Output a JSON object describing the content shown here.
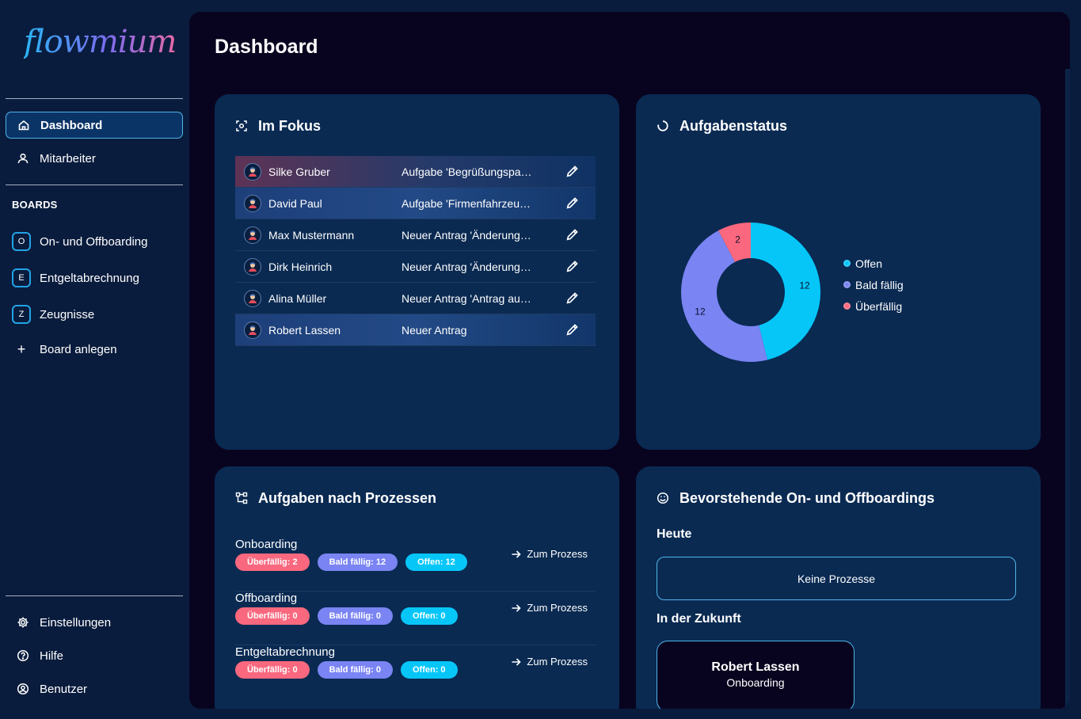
{
  "app": {
    "logo_text": "flowmium"
  },
  "sidebar": {
    "nav": [
      {
        "label": "Dashboard",
        "icon": "home-icon",
        "active": true
      },
      {
        "label": "Mitarbeiter",
        "icon": "user-icon",
        "active": false
      }
    ],
    "boards_heading": "BOARDS",
    "boards": [
      {
        "badge": "O",
        "label": "On- und Offboarding"
      },
      {
        "badge": "E",
        "label": "Entgeltabrechnung"
      },
      {
        "badge": "Z",
        "label": "Zeugnisse"
      }
    ],
    "add_board_label": "Board anlegen",
    "bottom": [
      {
        "label": "Einstellungen",
        "icon": "gear-icon"
      },
      {
        "label": "Hilfe",
        "icon": "help-icon"
      },
      {
        "label": "Benutzer",
        "icon": "user-circle-icon"
      }
    ]
  },
  "main": {
    "title": "Dashboard",
    "focus": {
      "title": "Im Fokus",
      "rows": [
        {
          "name": "Silke Gruber",
          "task": "Aufgabe 'Begrüßungspa…",
          "highlight": "red"
        },
        {
          "name": "David Paul",
          "task": "Aufgabe 'Firmenfahrzeu…",
          "highlight": "blue"
        },
        {
          "name": "Max Mustermann",
          "task": "Neuer Antrag 'Änderung…",
          "highlight": ""
        },
        {
          "name": "Dirk Heinrich",
          "task": "Neuer Antrag 'Änderung…",
          "highlight": ""
        },
        {
          "name": "Alina Müller",
          "task": "Neuer Antrag 'Antrag au…",
          "highlight": ""
        },
        {
          "name": "Robert Lassen",
          "task": "Neuer Antrag",
          "highlight": "blue"
        }
      ]
    },
    "status": {
      "title": "Aufgabenstatus",
      "legend": [
        "Offen",
        "Bald fällig",
        "Überfällig"
      ]
    },
    "processes": {
      "title": "Aufgaben nach Prozessen",
      "link_label": "Zum Prozess",
      "rows": [
        {
          "name": "Onboarding",
          "overdue": "Überfällig: 2",
          "soon": "Bald fällig: 12",
          "open": "Offen: 12"
        },
        {
          "name": "Offboarding",
          "overdue": "Überfällig: 0",
          "soon": "Bald fällig: 0",
          "open": "Offen: 0"
        },
        {
          "name": "Entgeltabrechnung",
          "overdue": "Überfällig: 0",
          "soon": "Bald fällig: 0",
          "open": "Offen: 0"
        }
      ]
    },
    "upcoming": {
      "title": "Bevorstehende On- und Offboardings",
      "today_heading": "Heute",
      "today_empty": "Keine Prozesse",
      "future_heading": "In der Zukunft",
      "future": [
        {
          "name": "Robert Lassen",
          "process": "Onboarding"
        }
      ]
    }
  },
  "chart_data": {
    "type": "pie",
    "style": "donut",
    "title": "Aufgabenstatus",
    "categories": [
      "Offen",
      "Bald fällig",
      "Überfällig"
    ],
    "values": [
      12,
      12,
      2
    ],
    "colors": [
      "#06c6f8",
      "#7a84f2",
      "#f9687e"
    ],
    "legend": "right"
  }
}
